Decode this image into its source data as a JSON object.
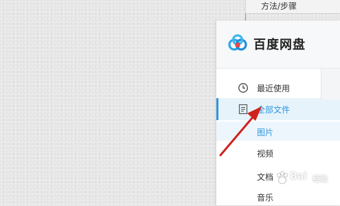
{
  "background_page": {
    "steps_tab_label": "方法/步骤"
  },
  "app": {
    "title": "百度网盘",
    "logo_icon": "baidu-netdisk-logo-icon"
  },
  "sidebar": {
    "items": [
      {
        "label": "最近使用",
        "icon": "clock-icon",
        "active": false
      },
      {
        "label": "全部文件",
        "icon": "document-icon",
        "active": true
      }
    ],
    "sub_items": [
      {
        "label": "图片",
        "active": true
      },
      {
        "label": "视频",
        "active": false
      },
      {
        "label": "文档",
        "active": false
      },
      {
        "label": "音乐",
        "active": false
      }
    ]
  },
  "watermark": {
    "brand": "Bai",
    "text": "经验"
  },
  "colors": {
    "accent": "#2b95e0",
    "active_bg": "#e6f3fb",
    "arrow": "#d0221c"
  }
}
